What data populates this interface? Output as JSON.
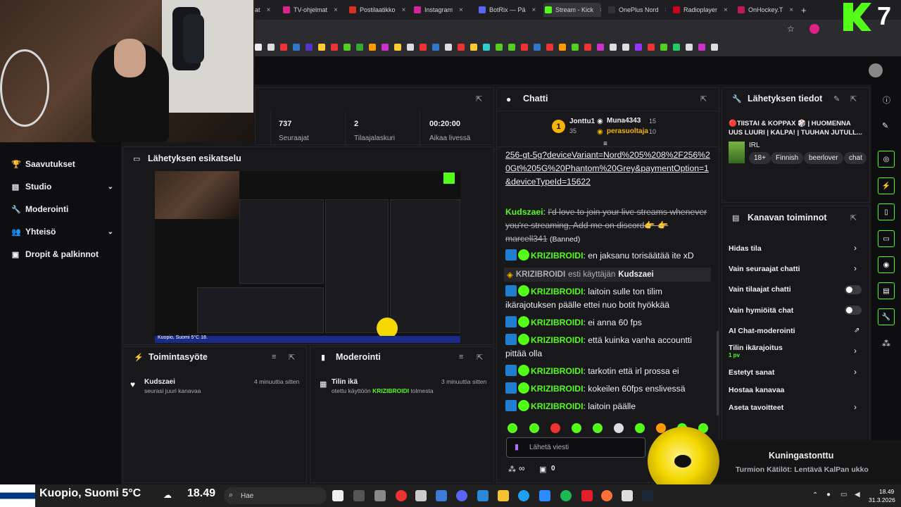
{
  "browser": {
    "tabs": [
      {
        "label": "at",
        "color": "#888888"
      },
      {
        "label": "TV-ohjelmat",
        "color": "#e0218a"
      },
      {
        "label": "Postilaatikko",
        "color": "#d93025"
      },
      {
        "label": "Instagram",
        "color": "#d6249f"
      },
      {
        "label": "BotRix — Pä",
        "color": "#5865f2"
      },
      {
        "label": "Stream - Kick",
        "color": "#53fc18"
      },
      {
        "label": "OnePlus Nord",
        "color": "#111111"
      },
      {
        "label": "Radioplayer",
        "color": "#d0021b"
      },
      {
        "label": "OnHockey.T",
        "color": "#c2185b"
      }
    ],
    "new_tab": "+",
    "tab_close": "×",
    "star_icon": "☆"
  },
  "brand": {
    "kick_number": "7",
    "accent": "#53fc18"
  },
  "sidebar": {
    "items": [
      {
        "label": "Saavutukset",
        "icon": "trophy-icon",
        "glyph": "🏆"
      },
      {
        "label": "Studio",
        "icon": "studio-icon",
        "glyph": "▤",
        "chevron": "⌄"
      },
      {
        "label": "Moderointi",
        "icon": "wrench-icon",
        "glyph": "🔧"
      },
      {
        "label": "Yhteisö",
        "icon": "people-icon",
        "glyph": "👥",
        "chevron": "⌄"
      },
      {
        "label": "Dropit & palkinnot",
        "icon": "gift-icon",
        "glyph": "▣"
      }
    ]
  },
  "stats": [
    {
      "value": "737",
      "label": "Seuraajat"
    },
    {
      "value": "2",
      "label": "Tilaajalaskuri"
    },
    {
      "value": "00:20:00",
      "label": "Aikaa livessä"
    }
  ],
  "preview": {
    "title": "Lähetyksen esikatselu",
    "ticker": "Kuopio, Suomi 5°C   18."
  },
  "activity": {
    "title": "Toimintasyöte",
    "items": [
      {
        "user": "Kudszaei",
        "text": "seurasi juuri kanavaa",
        "time": "4 minuuttia sitten"
      }
    ]
  },
  "moderation": {
    "title": "Moderointi",
    "items": [
      {
        "title": "Tilin ikä",
        "pre": "otettu käyttöön ",
        "user": "KRIZIBROIDI",
        "post": " tolmesta",
        "time": "3 minuuttia sitten"
      }
    ]
  },
  "chat": {
    "title": "Chatti",
    "top_gifters": [
      {
        "name": "Jonttu1",
        "count": "35"
      },
      {
        "name": "Muna4343",
        "count": "15"
      },
      {
        "name": "perasuoltaja",
        "count": "10"
      }
    ],
    "rank": "1",
    "link_text": "256-gt-5g?deviceVariant=Nord%205%208%2F256%20Gt%205G%20Phantom%20Grey&paymentOption=1&deviceTypeId=15622",
    "spam": {
      "user": "Kudszaei",
      "text": "I'd love to join your live streams whenever you're streaming, Add me on discord👉 👉 marcell341",
      "banned": "(Banned)"
    },
    "system": {
      "user": "KRIZIBROIDI",
      "mid": "esti käyttäjän",
      "target": "Kudszaei"
    },
    "messages": [
      {
        "user": "KRIZIBROIDI",
        "text": "en jaksanu torisäätää ite xD"
      },
      {
        "user": "KRIZIBROIDI",
        "text": "laitoin sulle ton tilim ikärajotuksen päälle ettei nuo botit hyökkää"
      },
      {
        "user": "KRIZIBROIDI",
        "text": "ei anna 60 fps"
      },
      {
        "user": "KRIZIBROIDI",
        "text": "että kuinka vanha accountti pittää olla"
      },
      {
        "user": "KRIZIBROIDI",
        "text": "tarkotin että irl prossa ei"
      },
      {
        "user": "KRIZIBROIDI",
        "text": "kokeilen 60fps enslivessä"
      },
      {
        "user": "KRIZIBROIDI",
        "text": "laitoin päälle"
      }
    ],
    "input_placeholder": "Lähetä viesti",
    "footer_count": "0",
    "footer_infinity": "∞"
  },
  "stream_info": {
    "title": "Lähetyksen tiedot",
    "stream_title": "🔴TIISTAI & KOPPAX 🎲 | HUOMENNA UUS LUURI | KALPA! | TUUHAN JUTULL...",
    "category": "IRL",
    "tags": [
      "18+",
      "Finnish",
      "beerlover",
      "chat"
    ]
  },
  "channel_actions": {
    "title": "Kanavan toiminnot",
    "items": [
      {
        "label": "Hidas tila",
        "control": "chevron"
      },
      {
        "label": "Vain seuraajat chatti",
        "control": "chevron"
      },
      {
        "label": "Vain tilaajat chatti",
        "control": "toggle"
      },
      {
        "label": "Vain hymiöitä chat",
        "control": "toggle"
      },
      {
        "label": "AI Chat-moderointi",
        "control": "external"
      },
      {
        "label": "Tilin ikärajoitus",
        "sub": "1 pv",
        "control": "chevron"
      },
      {
        "label": "Estetyt sanat",
        "control": "chevron"
      },
      {
        "label": "Hostaa kanavaa",
        "control": "none"
      },
      {
        "label": "Aseta tavoitteet",
        "control": "chevron"
      }
    ]
  },
  "notification": {
    "title": "Kuningastonttu",
    "subtitle": "Turmion Kätilöt: Lentävä KalPan ukko"
  },
  "taskbar": {
    "weather": "Kuopio, Suomi 5°C",
    "temp_short": "18.49",
    "search": "Hae",
    "time": "18.49",
    "date": "31.3.2026"
  }
}
